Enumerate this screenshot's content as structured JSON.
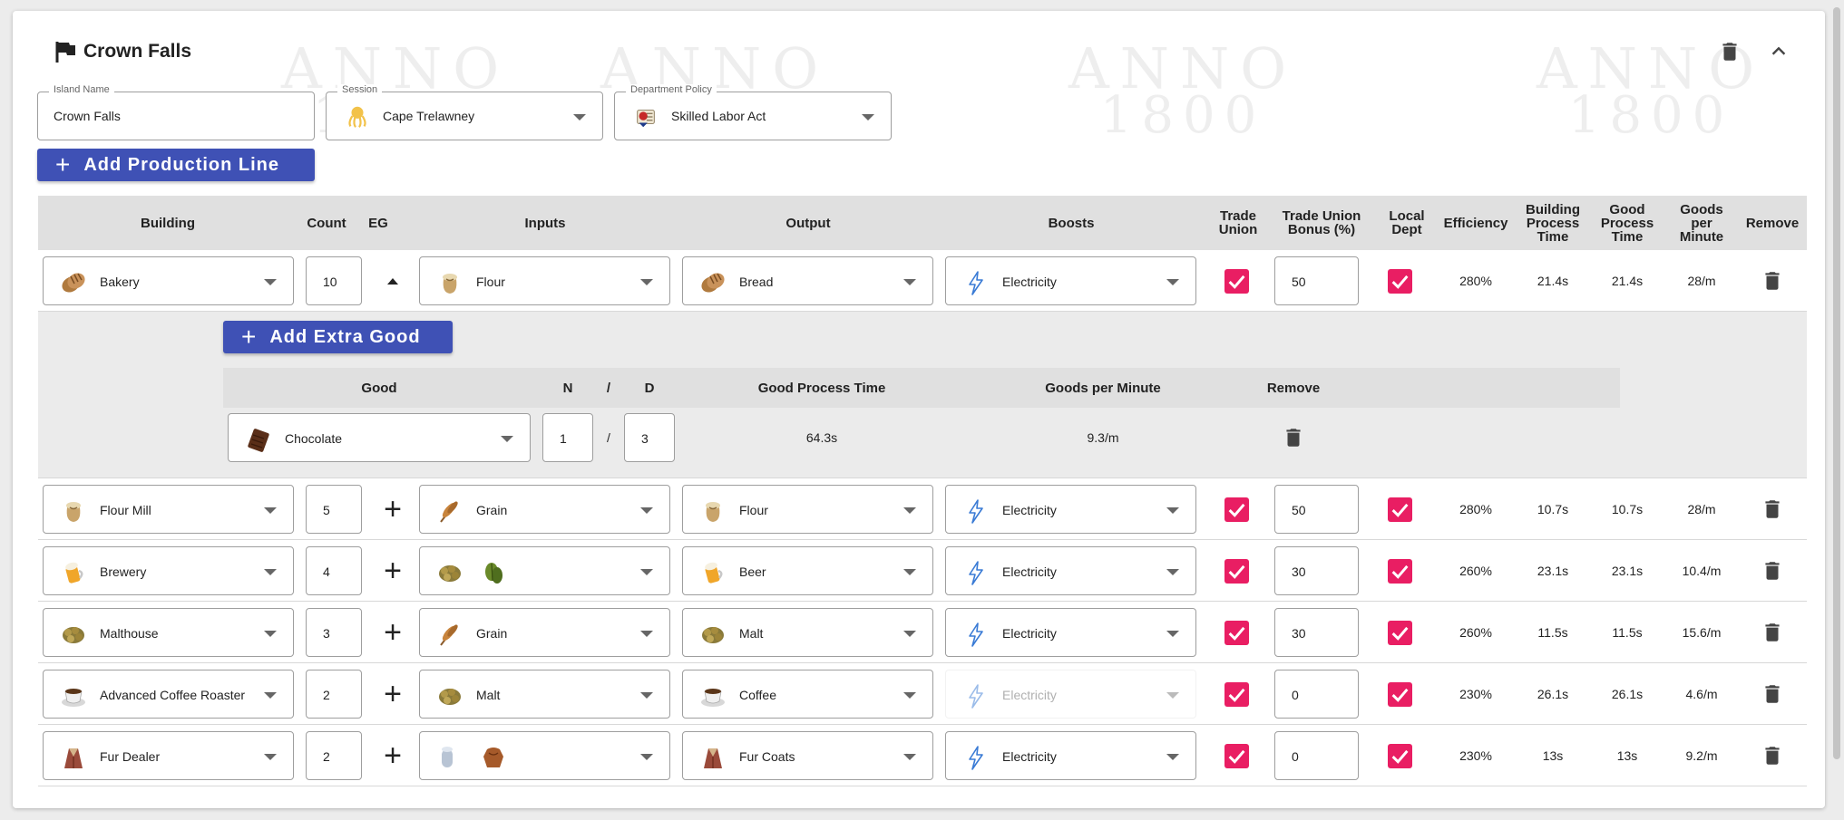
{
  "header": {
    "title": "Crown Falls",
    "watermark_top": "ANNO",
    "watermark_bottom": "1800"
  },
  "fields": {
    "island": {
      "label": "Island Name",
      "value": "Crown Falls"
    },
    "session": {
      "label": "Session",
      "value": "Cape Trelawney",
      "icon": "kraken-icon"
    },
    "policy": {
      "label": "Department Policy",
      "value": "Skilled Labor Act",
      "icon": "policy-scroll-icon"
    }
  },
  "buttons": {
    "add_production_line": "Add Production Line",
    "add_extra_good": "Add Extra Good"
  },
  "table": {
    "headers": {
      "building": "Building",
      "count": "Count",
      "eg": "EG",
      "inputs": "Inputs",
      "output": "Output",
      "boosts": "Boosts",
      "trade_union": "Trade Union",
      "trade_union_bonus": "Trade Union Bonus (%)",
      "local_dept": "Local Dept",
      "efficiency": "Efficiency",
      "building_process_time": "Building Process Time",
      "good_process_time": "Good Process Time",
      "goods_per_minute": "Goods per Minute",
      "remove": "Remove"
    },
    "rows": [
      {
        "building": "Bakery",
        "count": "10",
        "inputs": "Flour",
        "output": "Bread",
        "boost": "Electricity",
        "trade_union_bonus": "50",
        "efficiency": "280%",
        "bpt": "21.4s",
        "gpt": "21.4s",
        "gpm": "28/m"
      },
      {
        "building": "Flour Mill",
        "count": "5",
        "inputs": "Grain",
        "output": "Flour",
        "boost": "Electricity",
        "trade_union_bonus": "50",
        "efficiency": "280%",
        "bpt": "10.7s",
        "gpt": "10.7s",
        "gpm": "28/m"
      },
      {
        "building": "Brewery",
        "count": "4",
        "inputs": "",
        "output": "Beer",
        "boost": "Electricity",
        "trade_union_bonus": "30",
        "efficiency": "260%",
        "bpt": "23.1s",
        "gpt": "23.1s",
        "gpm": "10.4/m"
      },
      {
        "building": "Malthouse",
        "count": "3",
        "inputs": "Grain",
        "output": "Malt",
        "boost": "Electricity",
        "trade_union_bonus": "30",
        "efficiency": "260%",
        "bpt": "11.5s",
        "gpt": "11.5s",
        "gpm": "15.6/m"
      },
      {
        "building": "Advanced Coffee Roaster",
        "count": "2",
        "inputs": "Malt",
        "output": "Coffee",
        "boost": "Electricity",
        "trade_union_bonus": "0",
        "efficiency": "230%",
        "bpt": "26.1s",
        "gpt": "26.1s",
        "gpm": "4.6/m"
      },
      {
        "building": "Fur Dealer",
        "count": "2",
        "inputs": "",
        "output": "Fur Coats",
        "boost": "Electricity",
        "trade_union_bonus": "0",
        "efficiency": "230%",
        "bpt": "13s",
        "gpt": "13s",
        "gpm": "9.2/m"
      }
    ]
  },
  "extra_goods": {
    "headers": {
      "good": "Good",
      "n": "N",
      "slash": "/",
      "d": "D",
      "good_process_time": "Good Process Time",
      "goods_per_minute": "Goods per Minute",
      "remove": "Remove"
    },
    "rows": [
      {
        "good": "Chocolate",
        "n": "1",
        "slash": "/",
        "d": "3",
        "gpt": "64.3s",
        "gpm": "9.3/m"
      }
    ]
  },
  "colors": {
    "accent": "#3f51b5",
    "checkbox": "#e91e63",
    "header_bg": "#e0e0e0",
    "sub_bg": "#ebebeb"
  }
}
